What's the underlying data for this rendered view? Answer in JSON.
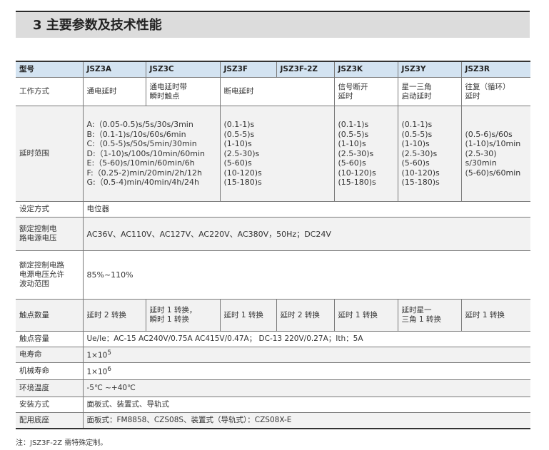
{
  "section_title": "3 主要参数及技术性能",
  "header": {
    "label": "型号",
    "models": [
      "JSZ3A",
      "JSZ3C",
      "JSZ3F",
      "JSZ3F-2Z",
      "JSZ3K",
      "JSZ3Y",
      "JSZ3R"
    ]
  },
  "rows": {
    "work_mode": {
      "label": "工作方式",
      "a": "通电延时",
      "c": "通电延时带\n瞬时触点",
      "f": "断电延时",
      "k": "信号断开\n延时",
      "y": "星一三角\n启动延时",
      "r": "往复（循环）\n延时"
    },
    "delay_range": {
      "label": "延时范围",
      "a": "A:（0.05-0.5)s/5s/30s/3min\nB:（0.1-1)s/10s/60s/6min\nC:（0.5-5)s/50s/5min/30min\nD:（1-10)s/100s/10min/60min\nE:（5-60)s/10min/60min/6h\nF:（0.25-2)min/20min/2h/12h\nG:（0.5-4)min/40min/4h/24h",
      "f": "(0.1-1)s\n(0.5-5)s\n(1-10)s\n(2.5-30)s\n(5-60)s\n(10-120)s\n(15-180)s",
      "k": "(0.1-1)s\n(0.5-5)s\n(1-10)s\n(2.5-30)s\n(5-60)s\n(10-120)s\n(15-180)s",
      "y": "(0.1-1)s\n(0.5-5)s\n(1-10)s\n(2.5-30)s\n(5-60)s\n(10-120)s\n(15-180)s",
      "r": "(0.5-6)s/60s\n(1-10)s/10min\n(2.5-30)\ns/30min\n(5-60)s/60min"
    },
    "setting": {
      "label": "设定方式",
      "value": "电位器"
    },
    "voltage": {
      "label": "额定控制电\n路电源电压",
      "value": "AC36V、AC110V、AC127V、AC220V、AC380V，50Hz；DC24V"
    },
    "fluctuation": {
      "label": "额定控制电路\n电源电压允许\n波动范围",
      "value": "85%~110%"
    },
    "contacts": {
      "label": "触点数量",
      "a": "延时 2 转换",
      "c": "延时 1 转换，\n瞬时 1 转换",
      "f": "延时 1 转换",
      "f2z": "延时 2 转换",
      "k": "延时 1 转换",
      "y": "延时星一\n三角 1 转换",
      "r": "延时 1 转换"
    },
    "capacity": {
      "label": "触点容量",
      "value": "Ue/Ie：AC-15 AC240V/0.75A AC415V/0.47A； DC-13 220V/0.27A；Ith：5A"
    },
    "elec_life": {
      "label": "电寿命",
      "base": "1×10",
      "exp": "5"
    },
    "mech_life": {
      "label": "机械寿命",
      "base": "1×10",
      "exp": "6"
    },
    "temperature": {
      "label": "环境温度",
      "value": "-5℃ ~+40℃"
    },
    "mounting": {
      "label": "安装方式",
      "value": "面板式、装置式、导轨式"
    },
    "socket": {
      "label": "配用底座",
      "value": "面板式：FM8858、CZS08S、装置式（导轨式）：CZS08X-E"
    }
  },
  "footnote": "注：JSZ3F-2Z 需特殊定制。"
}
